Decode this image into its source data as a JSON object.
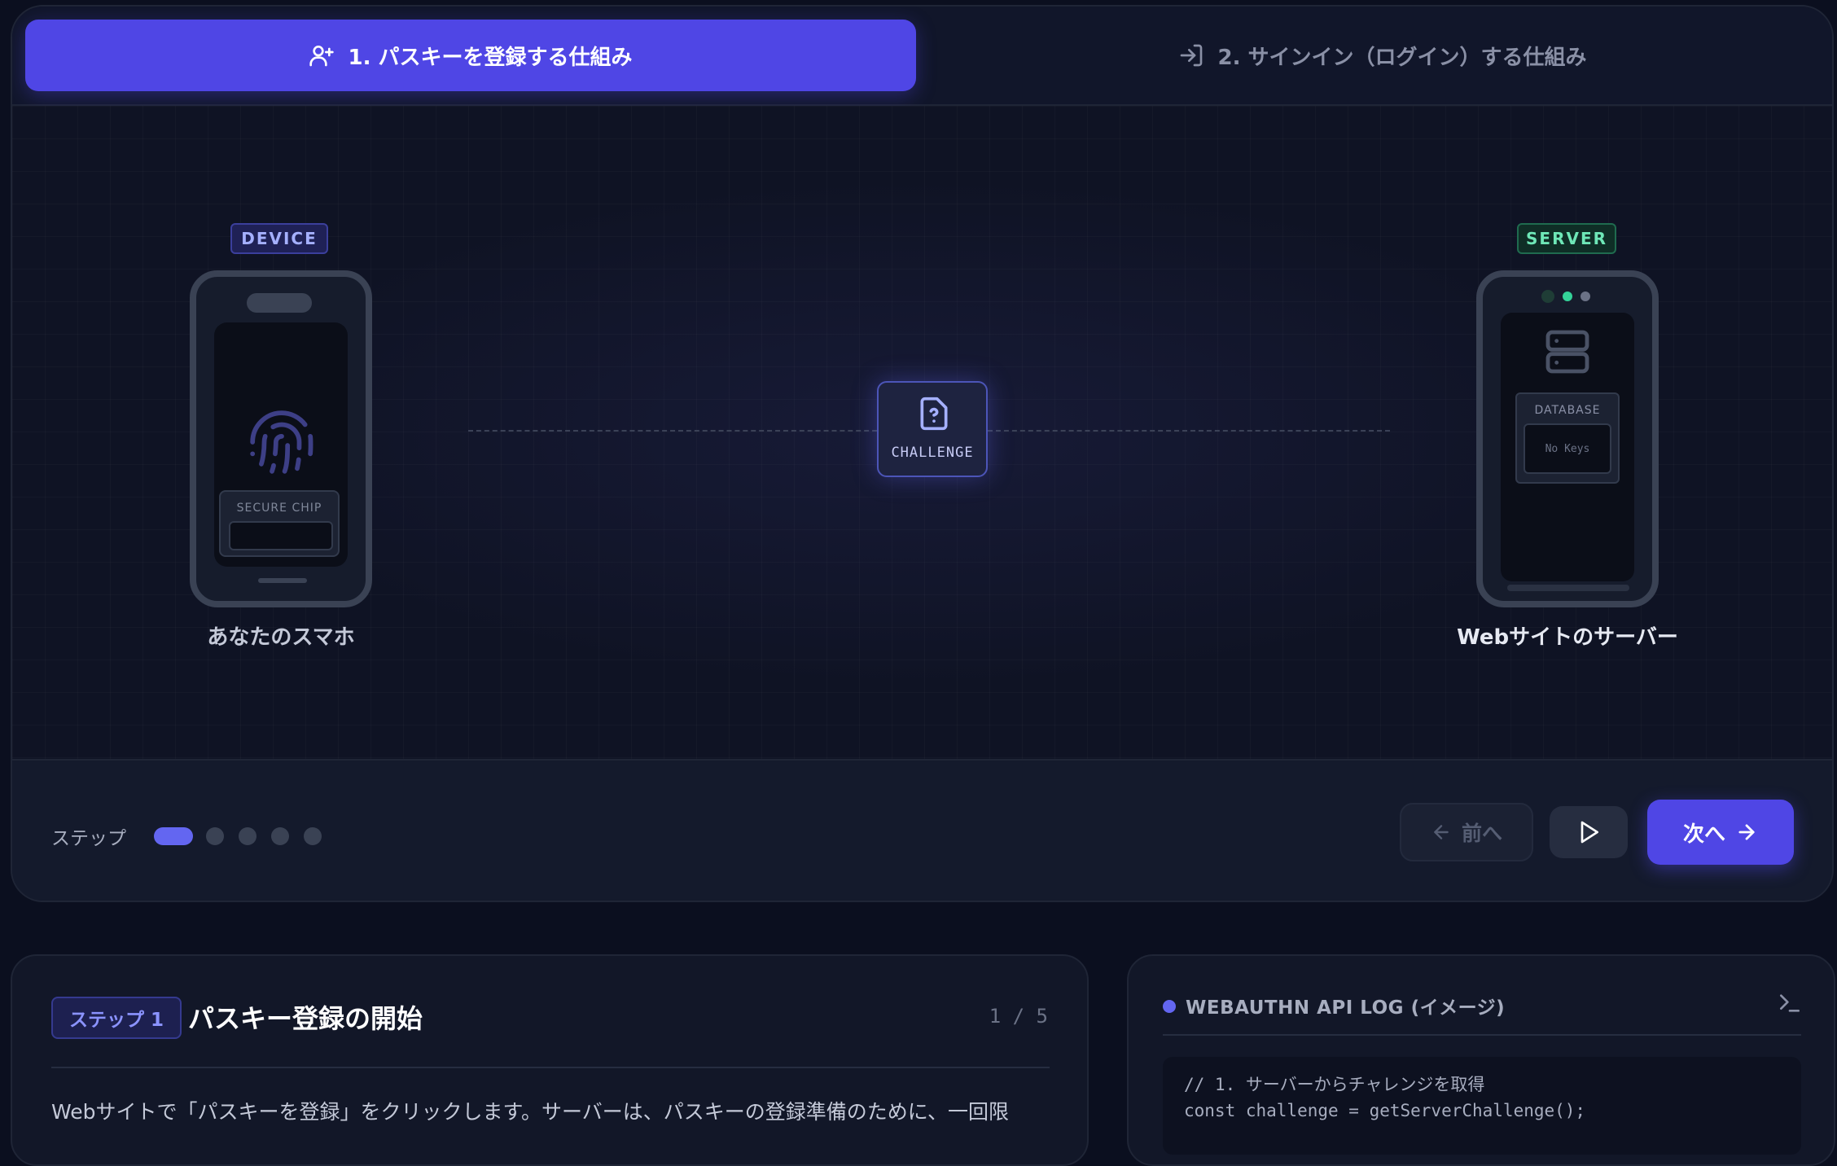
{
  "tabs": [
    {
      "label": "1. パスキーを登録する仕組み",
      "icon": "user-plus-icon",
      "active": true
    },
    {
      "label": "2. サインイン（ログイン）する仕組み",
      "icon": "sign-in-icon",
      "active": false
    }
  ],
  "stage": {
    "device": {
      "badge": "DEVICE",
      "chip_label": "SECURE CHIP",
      "caption": "あなたのスマホ"
    },
    "server": {
      "badge": "SERVER",
      "database_label": "DATABASE",
      "database_value": "No Keys",
      "caption": "Webサイトのサーバー"
    },
    "packet": {
      "label": "CHALLENGE",
      "icon": "file-question-icon"
    }
  },
  "stepper": {
    "label": "ステップ",
    "total": 5,
    "current": 1,
    "prev_label": "前へ",
    "next_label": "次へ"
  },
  "info": {
    "step_chip": "ステップ 1",
    "title": "パスキー登録の開始",
    "page_count": "1 / 5",
    "body": "Webサイトで「パスキーを登録」をクリックします。サーバーは、パスキーの登録準備のために、一回限"
  },
  "log": {
    "title": "WEBAUTHN API LOG (イメージ)",
    "code_comment": "// 1. サーバーからチャレンジを取得",
    "code_line": "const challenge = getServerChallenge();"
  },
  "colors": {
    "accent": "#4f46e5",
    "server_green": "#6ee7b7",
    "device_blue": "#a5b0ff",
    "background": "#0b0f1f"
  }
}
